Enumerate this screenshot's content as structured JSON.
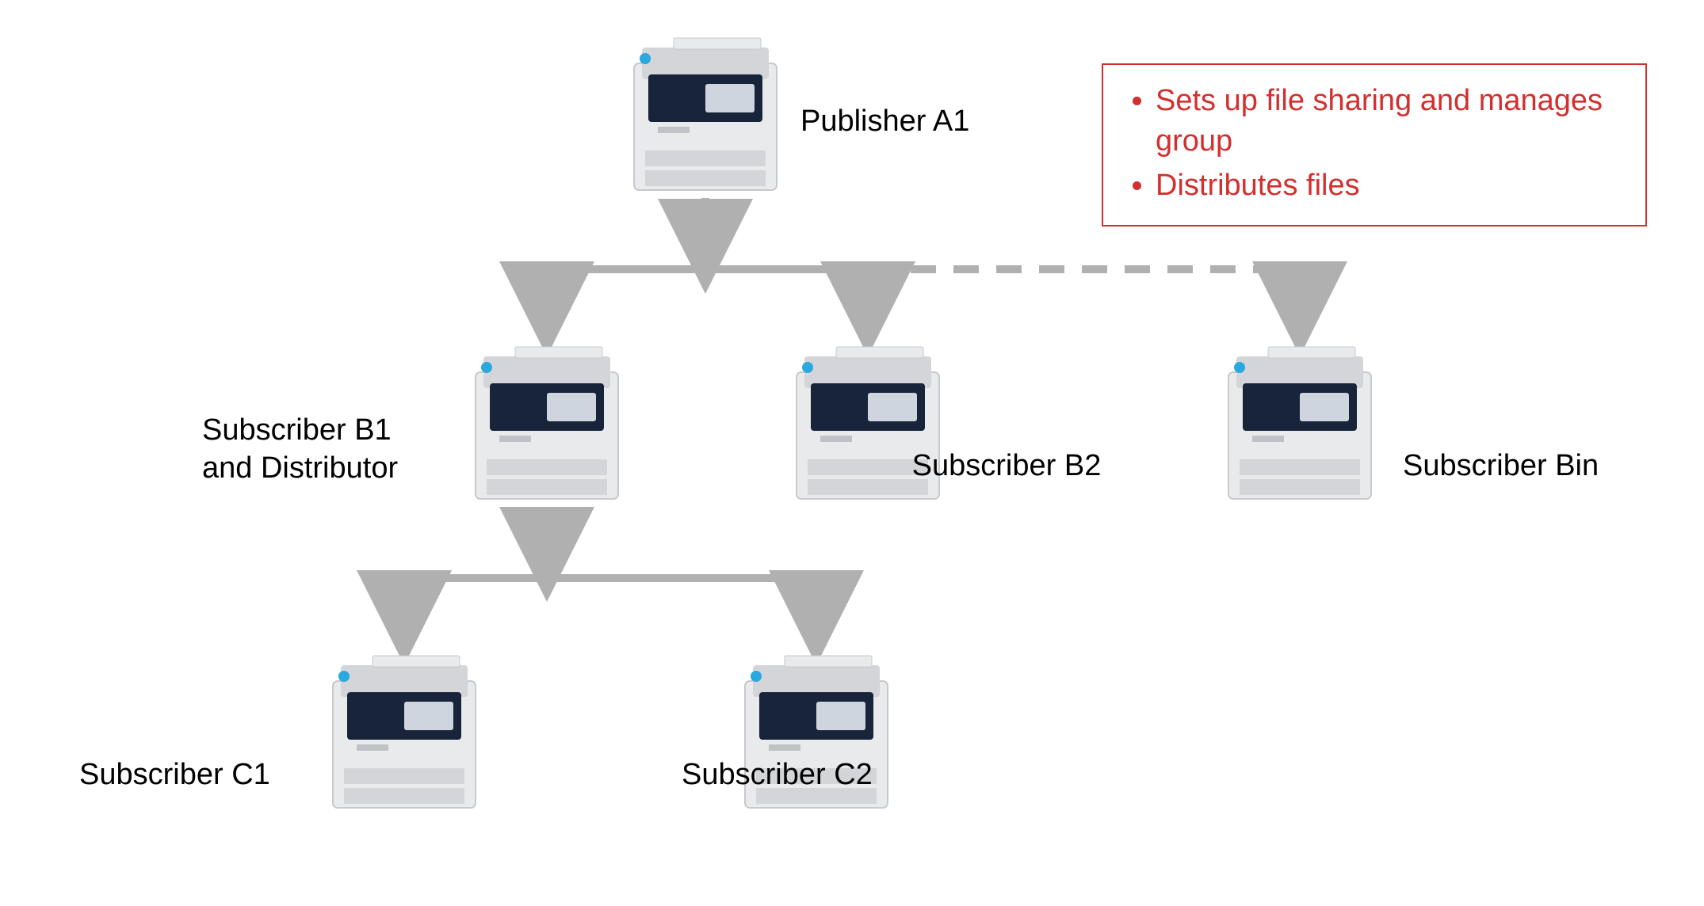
{
  "nodes": {
    "a1": {
      "label": "Publisher A1"
    },
    "b1": {
      "label_line1": "Subscriber B1",
      "label_line2": "and Distributor"
    },
    "b2": {
      "label": "Subscriber B2"
    },
    "bn": {
      "label": "Subscriber Bin"
    },
    "c1": {
      "label": "Subscriber C1"
    },
    "c2": {
      "label": "Subscriber C2"
    }
  },
  "callout": {
    "item1": "Sets up file sharing and manages group",
    "item2": "Distributes files"
  },
  "connections": [
    {
      "from": "a1",
      "to": "b1",
      "style": "solid"
    },
    {
      "from": "a1",
      "to": "b2",
      "style": "solid"
    },
    {
      "from": "a1",
      "to": "bn",
      "style": "dashed"
    },
    {
      "from": "b1",
      "to": "c1",
      "style": "solid"
    },
    {
      "from": "b1",
      "to": "c2",
      "style": "solid"
    }
  ]
}
